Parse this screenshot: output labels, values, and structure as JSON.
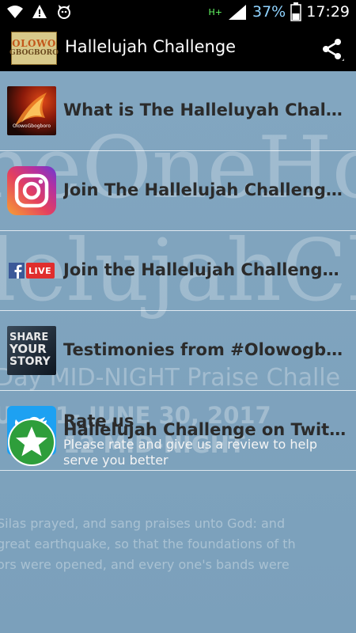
{
  "status_bar": {
    "battery_percent": "37%",
    "time": "17:29",
    "network": "H+"
  },
  "app_bar": {
    "logo_line1": "OLOWO",
    "logo_line2": "GBOGBORO",
    "title": "Hallelujah Challenge"
  },
  "background": {
    "line1": "heOneHo",
    "line2": "lelujahCha",
    "line3": "Day MID-NIGHT Praise Challe",
    "line4": "UNE 1- JUNE 30, 2017",
    "line5": "12 MID-NIGHT",
    "line6": "Silas prayed, and sang praises unto God: and",
    "line7": "great earthquake, so that the foundations of th",
    "line8": "ors were opened, and every one's bands were"
  },
  "menu": {
    "items": [
      {
        "label": "What is The Halleluyah Challenge?",
        "thumb_caption": "OlowoGbogboro"
      },
      {
        "label": "Join The Hallelujah Challenge on Instagram"
      },
      {
        "label": "Join the Hallelujah Challenge on Facebook",
        "live_label": "LIVE"
      },
      {
        "label": "Testimonies from #Olowogboro",
        "thumb_lines": [
          "SHARE",
          "YOUR",
          "STORY"
        ]
      },
      {
        "label": "Hallelujah Challenge on Twitter"
      }
    ],
    "rate": {
      "title": "Rate us",
      "subtitle": "Please rate and give us a review to help serve you better"
    }
  }
}
